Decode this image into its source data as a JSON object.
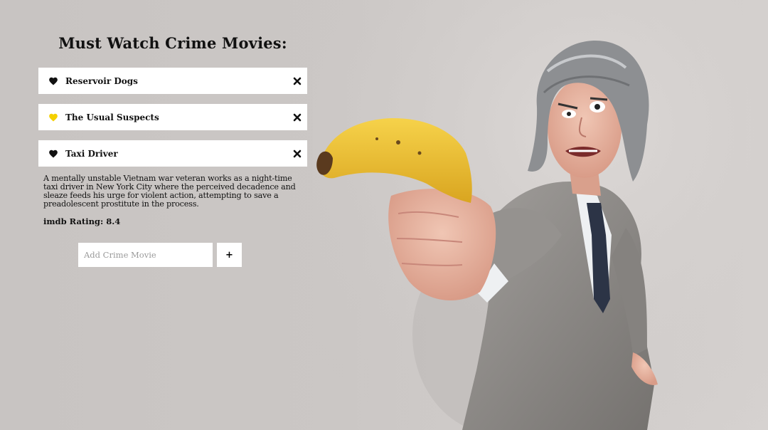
{
  "page": {
    "title": "Must Watch Crime Movies:"
  },
  "colors": {
    "background": "#cbc7c5",
    "heart_default": "#111111",
    "heart_favorite": "#f4d000",
    "banana": "#f2c53d",
    "suit": "#8e8b88"
  },
  "movies": [
    {
      "title": "Reservoir Dogs",
      "favorite": false,
      "heart_icon": "heart-icon",
      "remove_icon": "close-icon"
    },
    {
      "title": "The Usual Suspects",
      "favorite": true,
      "heart_icon": "heart-icon",
      "remove_icon": "close-icon"
    },
    {
      "title": "Taxi Driver",
      "favorite": false,
      "heart_icon": "heart-icon",
      "remove_icon": "close-icon"
    }
  ],
  "selected": {
    "description": "A mentally unstable Vietnam war veteran works as a night-time taxi driver in New York City where the perceived decadence and sleaze feeds his urge for violent action, attempting to save a preadolescent prostitute in the process.",
    "rating": "imdb Rating: 8.4"
  },
  "add_form": {
    "placeholder": "Add Crime Movie",
    "value": "",
    "button_label": "+"
  },
  "hero_image": {
    "subject": "man in grey suit pointing a banana like a gun"
  }
}
